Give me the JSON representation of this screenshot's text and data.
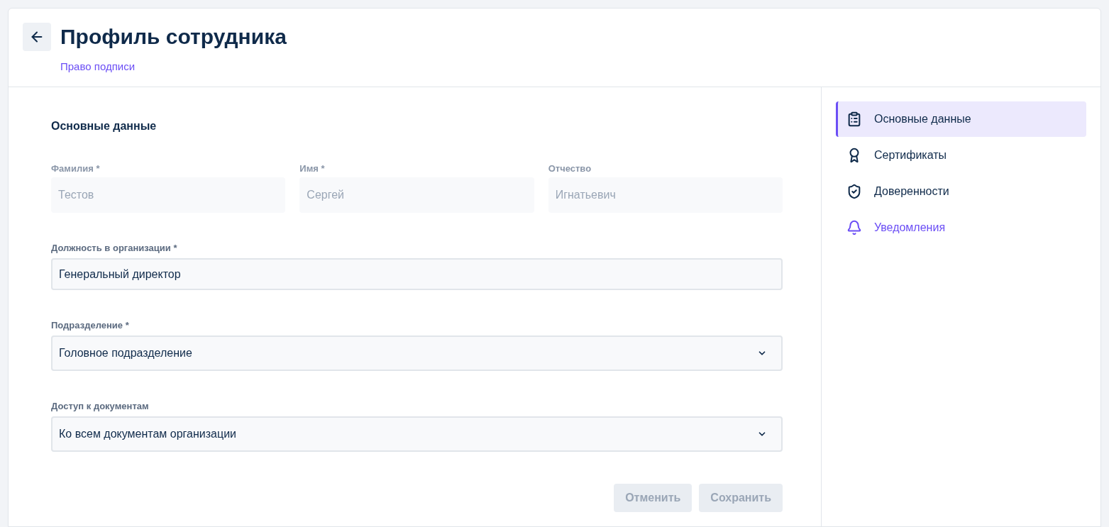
{
  "header": {
    "title": "Профиль сотрудника",
    "subtitle": "Право подписи"
  },
  "section_title": "Основные данные",
  "name_fields": [
    {
      "label": "Фамилия *",
      "value": "Тестов",
      "disabled": true
    },
    {
      "label": "Имя *",
      "value": "Сергей",
      "disabled": true
    },
    {
      "label": "Отчество",
      "value": "Игнатьевич",
      "disabled": true
    }
  ],
  "fields": [
    {
      "kind": "text",
      "label": "Должность в организации *",
      "value": "Генеральный директор"
    },
    {
      "kind": "select",
      "label": "Подразделение *",
      "value": "Головное подразделение"
    },
    {
      "kind": "select",
      "label": "Доступ к документам",
      "value": "Ко всем документам организации"
    }
  ],
  "buttons": [
    {
      "label": "Отменить",
      "disabled": true
    },
    {
      "label": "Сохранить",
      "disabled": true
    }
  ],
  "nav": [
    {
      "label": "Основные данные",
      "selected": true,
      "accent": false
    },
    {
      "label": "Сертификаты",
      "selected": false,
      "accent": false
    },
    {
      "label": "Доверенности",
      "selected": false,
      "accent": false
    },
    {
      "label": "Уведомления",
      "selected": false,
      "accent": true
    }
  ]
}
